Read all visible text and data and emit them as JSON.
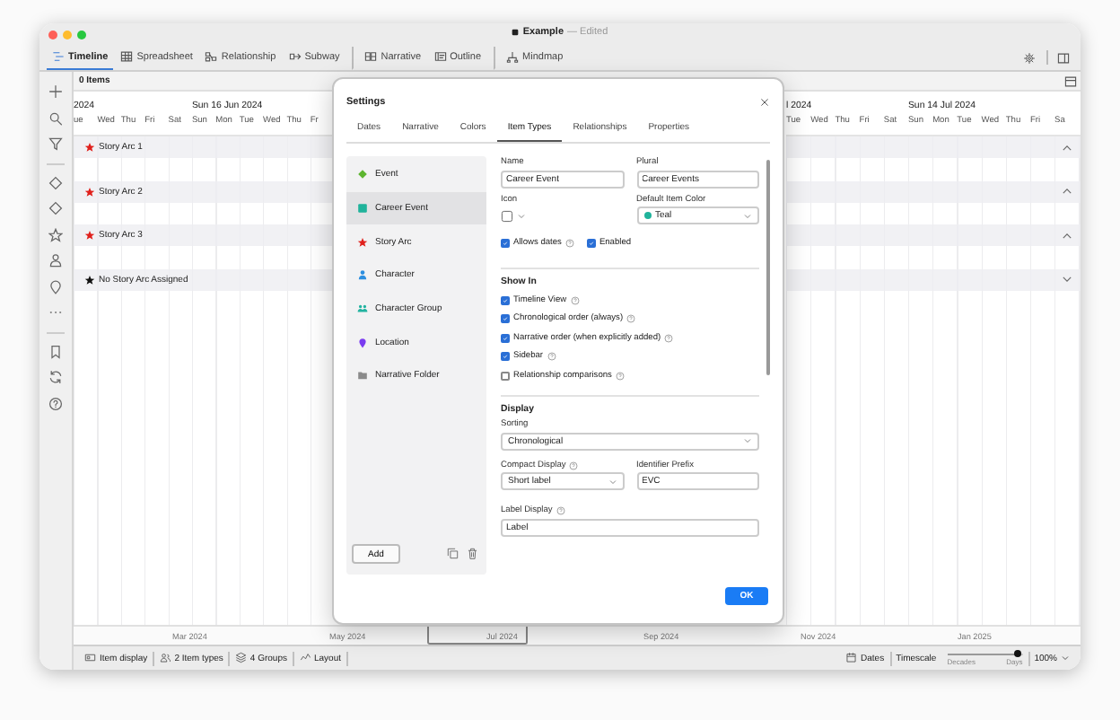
{
  "window": {
    "title": "Example",
    "status": "— Edited"
  },
  "views": [
    {
      "label": "Timeline",
      "selected": true,
      "divider_before": false
    },
    {
      "label": "Spreadsheet",
      "selected": false,
      "divider_before": false
    },
    {
      "label": "Relationship",
      "selected": false,
      "divider_before": false
    },
    {
      "label": "Subway",
      "selected": false,
      "divider_before": false
    },
    {
      "label": "Narrative",
      "selected": false,
      "divider_before": true
    },
    {
      "label": "Outline",
      "selected": false,
      "divider_before": false
    },
    {
      "label": "Mindmap",
      "selected": false,
      "divider_before": true
    }
  ],
  "timeline": {
    "item_count": "0 Items",
    "panes": [
      {
        "days": [
          {
            "label": "ue",
            "week_label": "2024"
          },
          {
            "label": "Wed"
          },
          {
            "label": "Thu"
          },
          {
            "label": "Fri"
          },
          {
            "label": "Sat"
          },
          {
            "label": "Sun",
            "week_label": "Sun 16 Jun 2024"
          },
          {
            "label": "Mon"
          },
          {
            "label": "Tue"
          },
          {
            "label": "Wed"
          },
          {
            "label": "Thu"
          },
          {
            "label": "Fr"
          }
        ]
      },
      {
        "days": [
          {
            "label": "Tue",
            "week_label": "l 2024"
          },
          {
            "label": "Wed"
          },
          {
            "label": "Thu"
          },
          {
            "label": "Fri"
          },
          {
            "label": "Sat"
          },
          {
            "label": "Sun",
            "week_label": "Sun 14 Jul 2024"
          },
          {
            "label": "Mon"
          },
          {
            "label": "Tue"
          },
          {
            "label": "Wed"
          },
          {
            "label": "Thu"
          },
          {
            "label": "Fri"
          },
          {
            "label": "Sa"
          }
        ]
      }
    ],
    "rows": [
      {
        "label": "Story Arc 1",
        "color": "#e0201c",
        "expanded": true
      },
      {
        "label": "Story Arc 2",
        "color": "#e0201c",
        "expanded": true
      },
      {
        "label": "Story Arc 3",
        "color": "#e0201c",
        "expanded": true
      },
      {
        "label": "No Story Arc Assigned",
        "color": "#111111",
        "expanded": false
      }
    ]
  },
  "overview": {
    "labels": [
      "Mar 2024",
      "May 2024",
      "Jul 2024",
      "Sep 2024",
      "Nov 2024",
      "Jan 2025"
    ]
  },
  "settings": {
    "title": "Settings",
    "tabs": [
      {
        "label": "Dates",
        "selected": false
      },
      {
        "label": "Narrative",
        "selected": false
      },
      {
        "label": "Colors",
        "selected": false
      },
      {
        "label": "Item Types",
        "selected": true
      },
      {
        "label": "Relationships",
        "selected": false
      },
      {
        "label": "Properties",
        "selected": false
      }
    ],
    "item_types": [
      {
        "label": "Event",
        "kind": "diamond",
        "color": "#5db52f",
        "selected": false
      },
      {
        "label": "Career Event",
        "kind": "square",
        "color": "#20b39b",
        "selected": true
      },
      {
        "label": "Story Arc",
        "kind": "star",
        "color": "#e0201c",
        "selected": false
      },
      {
        "label": "Character",
        "kind": "person",
        "color": "#2d8fe0",
        "selected": false
      },
      {
        "label": "Character Group",
        "kind": "group",
        "color": "#22b3a0",
        "selected": false
      },
      {
        "label": "Location",
        "kind": "pin",
        "color": "#7a3cf0",
        "selected": false
      },
      {
        "label": "Narrative Folder",
        "kind": "folder",
        "color": "#8a8a8a",
        "selected": false
      }
    ],
    "add_button": "Add",
    "form": {
      "name_label": "Name",
      "name": "Career Event",
      "plural_label": "Plural",
      "plural": "Career Events",
      "icon_label": "Icon",
      "color_label": "Default Item Color",
      "color_value": "Teal",
      "color": "#20b39b",
      "allows_dates": {
        "label": "Allows dates",
        "checked": true,
        "help": true
      },
      "enabled": {
        "label": "Enabled",
        "checked": true,
        "help": false
      },
      "show_in_title": "Show In",
      "show_in": [
        {
          "label": "Timeline View",
          "checked": true,
          "help": true
        },
        {
          "label": "Chronological order (always)",
          "checked": true,
          "help": true
        },
        {
          "label": "Narrative order (when explicitly added)",
          "checked": true,
          "help": true
        },
        {
          "label": "Sidebar",
          "checked": true,
          "help": true
        },
        {
          "label": "Relationship comparisons",
          "checked": false,
          "help": true
        }
      ],
      "display_title": "Display",
      "sorting_label": "Sorting",
      "sorting": "Chronological",
      "compact_label": "Compact Display",
      "compact": "Short label",
      "prefix_label": "Identifier Prefix",
      "prefix": "EVC",
      "label_display_label": "Label Display",
      "label_display": "Label"
    },
    "ok_button": "OK"
  },
  "status_bar": {
    "items": [
      "Item display",
      "2 Item types",
      "4 Groups",
      "Layout"
    ],
    "dates": "Dates",
    "timescale": {
      "label": "Timescale",
      "min_label": "Decades",
      "max_label": "Days",
      "level": 0.93
    },
    "zoom": "100%"
  }
}
